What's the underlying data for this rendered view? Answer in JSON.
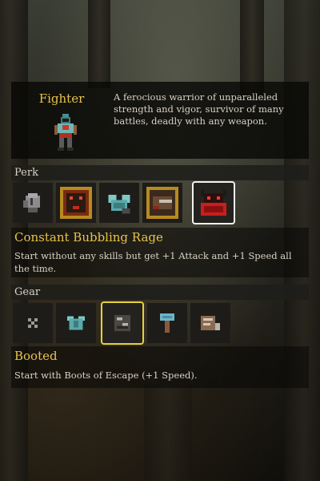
{
  "hero": {
    "name": "Fighter",
    "description": "A ferocious warrior of unparalleled strength and vigor, survivor of many battles, deadly with any weapon."
  },
  "perk": {
    "header": "Perk",
    "items": [
      {
        "icon": "gauntlet-icon"
      },
      {
        "icon": "berserker-icon"
      },
      {
        "icon": "chainmail-icon"
      },
      {
        "icon": "tanned-hide-icon"
      },
      {
        "icon": "rage-demon-icon",
        "selected": true
      }
    ],
    "selected_title": "Constant Bubbling Rage",
    "selected_description": "Start without any skills but get +1 Attack and +1 Speed all the time."
  },
  "gear": {
    "header": "Gear",
    "items": [
      {
        "icon": "none-icon"
      },
      {
        "icon": "chainmail-icon"
      },
      {
        "icon": "boots-icon",
        "selected": true
      },
      {
        "icon": "hammer-icon"
      },
      {
        "icon": "scroll-icon"
      }
    ],
    "selected_title": "Booted",
    "selected_description": "Start with Boots of Escape (+1 Speed)."
  },
  "colors": {
    "accent_gold": "#e8c34a",
    "selected_white": "#f2f2ee",
    "selected_yellow": "#e6d23a"
  }
}
